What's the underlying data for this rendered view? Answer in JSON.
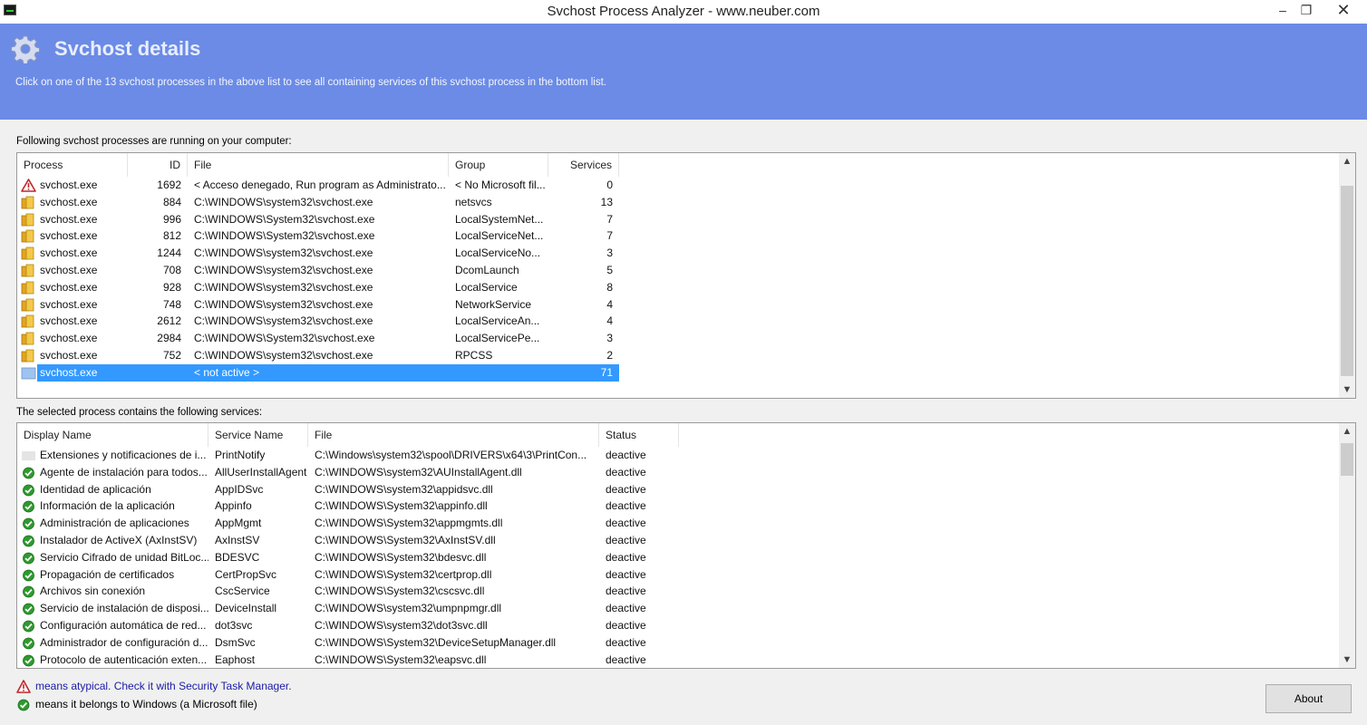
{
  "window": {
    "title": "Svchost Process Analyzer - www.neuber.com",
    "min_label": "–",
    "max_label": "❐",
    "close_label": "✕"
  },
  "header": {
    "title": "Svchost details",
    "description": "Click on one of the 13 svchost processes in the above list to see all containing services of this svchost process in the bottom list.",
    "background": "#6b8be6"
  },
  "processes": {
    "label": "Following svchost processes are running on your computer:",
    "columns": [
      "Process",
      "ID",
      "File",
      "Group",
      "Services"
    ],
    "rows": [
      {
        "icon": "warning-icon",
        "process": "svchost.exe",
        "id": "1692",
        "file": "< Acceso denegado, Run program as Administrato...",
        "group": "< No Microsoft fil...",
        "services": "0"
      },
      {
        "icon": "folder-icon",
        "process": "svchost.exe",
        "id": "884",
        "file": "C:\\WINDOWS\\system32\\svchost.exe",
        "group": "netsvcs",
        "services": "13"
      },
      {
        "icon": "folder-icon",
        "process": "svchost.exe",
        "id": "996",
        "file": "C:\\WINDOWS\\System32\\svchost.exe",
        "group": "LocalSystemNet...",
        "services": "7"
      },
      {
        "icon": "folder-icon",
        "process": "svchost.exe",
        "id": "812",
        "file": "C:\\WINDOWS\\System32\\svchost.exe",
        "group": "LocalServiceNet...",
        "services": "7"
      },
      {
        "icon": "folder-icon",
        "process": "svchost.exe",
        "id": "1244",
        "file": "C:\\WINDOWS\\system32\\svchost.exe",
        "group": "LocalServiceNo...",
        "services": "3"
      },
      {
        "icon": "folder-icon",
        "process": "svchost.exe",
        "id": "708",
        "file": "C:\\WINDOWS\\system32\\svchost.exe",
        "group": "DcomLaunch",
        "services": "5"
      },
      {
        "icon": "folder-icon",
        "process": "svchost.exe",
        "id": "928",
        "file": "C:\\WINDOWS\\system32\\svchost.exe",
        "group": "LocalService",
        "services": "8"
      },
      {
        "icon": "folder-icon",
        "process": "svchost.exe",
        "id": "748",
        "file": "C:\\WINDOWS\\system32\\svchost.exe",
        "group": "NetworkService",
        "services": "4"
      },
      {
        "icon": "folder-icon",
        "process": "svchost.exe",
        "id": "2612",
        "file": "C:\\WINDOWS\\system32\\svchost.exe",
        "group": "LocalServiceAn...",
        "services": "4"
      },
      {
        "icon": "folder-icon",
        "process": "svchost.exe",
        "id": "2984",
        "file": "C:\\WINDOWS\\System32\\svchost.exe",
        "group": "LocalServicePe...",
        "services": "3"
      },
      {
        "icon": "folder-icon",
        "process": "svchost.exe",
        "id": "752",
        "file": "C:\\WINDOWS\\system32\\svchost.exe",
        "group": "RPCSS",
        "services": "2"
      },
      {
        "icon": "inactive-icon",
        "process": "svchost.exe",
        "id": "",
        "file": "< not active >",
        "group": "",
        "services": "71",
        "selected": true
      }
    ]
  },
  "services": {
    "label": "The selected process contains the following services:",
    "columns": [
      "Display Name",
      "Service Name",
      "File",
      "Status"
    ],
    "rows": [
      {
        "icon": "blank-icon",
        "display": "Extensiones y notificaciones de i...",
        "service": "PrintNotify",
        "file": "C:\\Windows\\system32\\spool\\DRIVERS\\x64\\3\\PrintCon...",
        "status": "deactive"
      },
      {
        "icon": "check-icon",
        "display": "Agente de instalación para todos...",
        "service": "AllUserInstallAgent",
        "file": "C:\\WINDOWS\\system32\\AUInstallAgent.dll",
        "status": "deactive"
      },
      {
        "icon": "check-icon",
        "display": "Identidad de aplicación",
        "service": "AppIDSvc",
        "file": "C:\\WINDOWS\\system32\\appidsvc.dll",
        "status": "deactive"
      },
      {
        "icon": "check-icon",
        "display": "Información de la aplicación",
        "service": "Appinfo",
        "file": "C:\\WINDOWS\\System32\\appinfo.dll",
        "status": "deactive"
      },
      {
        "icon": "check-icon",
        "display": "Administración de aplicaciones",
        "service": "AppMgmt",
        "file": "C:\\WINDOWS\\System32\\appmgmts.dll",
        "status": "deactive"
      },
      {
        "icon": "check-icon",
        "display": "Instalador de ActiveX (AxInstSV)",
        "service": "AxInstSV",
        "file": "C:\\WINDOWS\\System32\\AxInstSV.dll",
        "status": "deactive"
      },
      {
        "icon": "check-icon",
        "display": "Servicio Cifrado de unidad BitLoc...",
        "service": "BDESVC",
        "file": "C:\\WINDOWS\\System32\\bdesvc.dll",
        "status": "deactive"
      },
      {
        "icon": "check-icon",
        "display": "Propagación de certificados",
        "service": "CertPropSvc",
        "file": "C:\\WINDOWS\\System32\\certprop.dll",
        "status": "deactive"
      },
      {
        "icon": "check-icon",
        "display": "Archivos sin conexión",
        "service": "CscService",
        "file": "C:\\WINDOWS\\System32\\cscsvc.dll",
        "status": "deactive"
      },
      {
        "icon": "check-icon",
        "display": "Servicio de instalación de disposi...",
        "service": "DeviceInstall",
        "file": "C:\\WINDOWS\\system32\\umpnpmgr.dll",
        "status": "deactive"
      },
      {
        "icon": "check-icon",
        "display": "Configuración automática de red...",
        "service": "dot3svc",
        "file": "C:\\WINDOWS\\system32\\dot3svc.dll",
        "status": "deactive"
      },
      {
        "icon": "check-icon",
        "display": "Administrador de configuración d...",
        "service": "DsmSvc",
        "file": "C:\\WINDOWS\\System32\\DeviceSetupManager.dll",
        "status": "deactive"
      },
      {
        "icon": "check-icon",
        "display": "Protocolo de autenticación exten...",
        "service": "Eaphost",
        "file": "C:\\WINDOWS\\System32\\eapsvc.dll",
        "status": "deactive"
      }
    ]
  },
  "legend": {
    "atypical": "means atypical. Check it with Security Task Manager.",
    "microsoft": "means it belongs to Windows (a Microsoft file)",
    "link_color": "#1a1aa6"
  },
  "buttons": {
    "about": "About"
  }
}
